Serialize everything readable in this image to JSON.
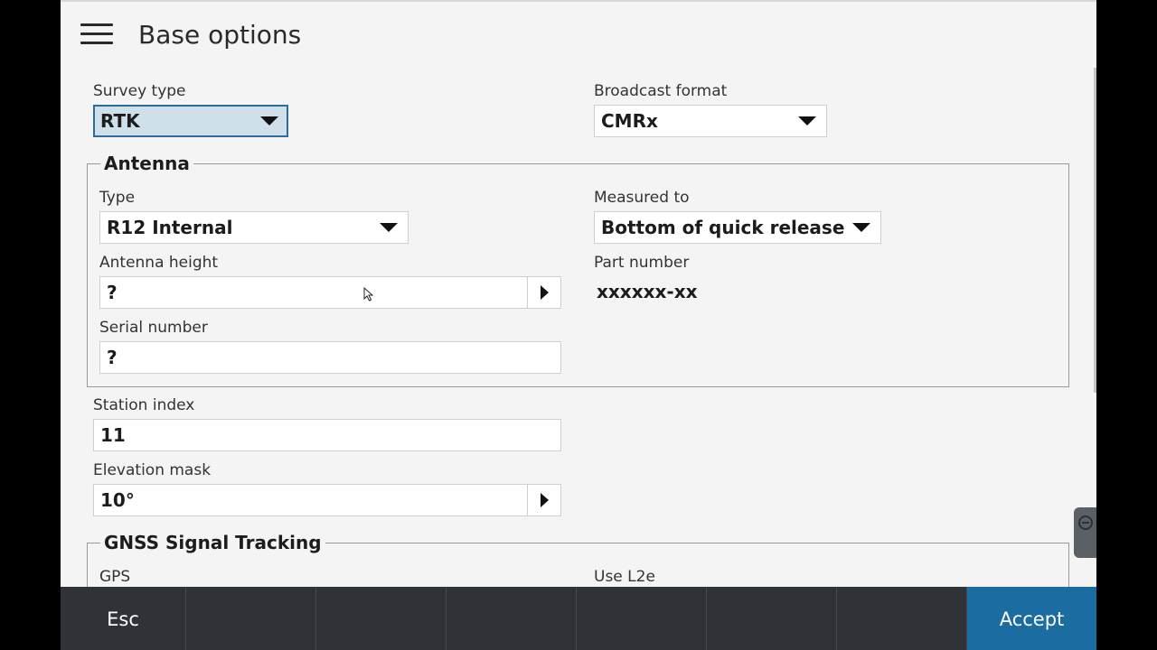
{
  "header": {
    "title": "Base options"
  },
  "survey_type": {
    "label": "Survey type",
    "value": "RTK"
  },
  "broadcast_format": {
    "label": "Broadcast format",
    "value": "CMRx"
  },
  "antenna": {
    "legend": "Antenna",
    "type": {
      "label": "Type",
      "value": "R12 Internal"
    },
    "measured_to": {
      "label": "Measured to",
      "value": "Bottom of quick release"
    },
    "height": {
      "label": "Antenna height",
      "value": "?"
    },
    "part_number": {
      "label": "Part number",
      "value": "xxxxxx-xx"
    },
    "serial": {
      "label": "Serial number",
      "value": "?"
    }
  },
  "station_index": {
    "label": "Station index",
    "value": "11"
  },
  "elevation_mask": {
    "label": "Elevation mask",
    "value": "10°"
  },
  "gnss": {
    "legend": "GNSS Signal Tracking",
    "gps_label": "GPS",
    "use_l2e_label": "Use L2e"
  },
  "footer": {
    "esc_label": "Esc",
    "accept_label": "Accept"
  },
  "colors": {
    "accent": "#1b6ca1",
    "footer_bg": "#2f3338",
    "selected_bg": "#cfe0ea",
    "selected_border": "#2a6d9a"
  }
}
